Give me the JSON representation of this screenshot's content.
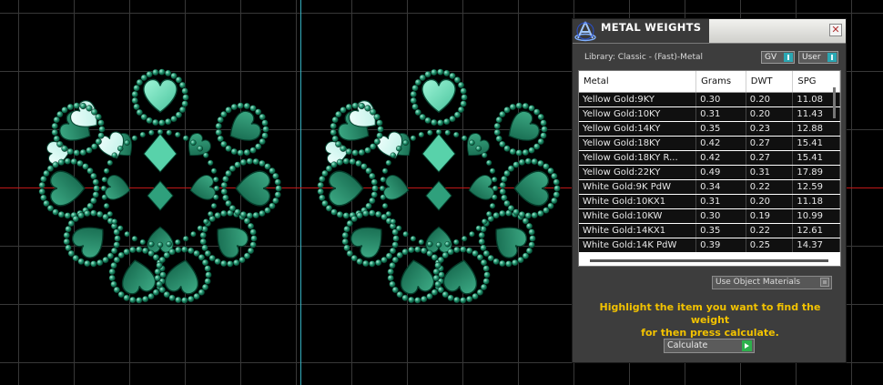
{
  "panel": {
    "title": "METAL WEIGHTS",
    "close_icon": "close-icon",
    "logo_icon": "matrix-logo-icon",
    "library_label": "Library: Classic - (Fast)-Metal",
    "gv_toggle": "GV",
    "user_toggle": "User",
    "table": {
      "columns": [
        "Metal",
        "Grams",
        "DWT",
        "SPG"
      ],
      "rows": [
        [
          "Yellow Gold:9KY",
          "0.30",
          "0.20",
          "11.08"
        ],
        [
          "Yellow Gold:10KY",
          "0.31",
          "0.20",
          "11.43"
        ],
        [
          "Yellow Gold:14KY",
          "0.35",
          "0.23",
          "12.88"
        ],
        [
          "Yellow Gold:18KY",
          "0.42",
          "0.27",
          "15.41"
        ],
        [
          "Yellow Gold:18KY R...",
          "0.42",
          "0.27",
          "15.41"
        ],
        [
          "Yellow Gold:22KY",
          "0.49",
          "0.31",
          "17.89"
        ],
        [
          "White Gold:9K PdW",
          "0.34",
          "0.22",
          "12.59"
        ],
        [
          "White Gold:10KX1",
          "0.31",
          "0.20",
          "11.18"
        ],
        [
          "White Gold:10KW",
          "0.30",
          "0.19",
          "10.99"
        ],
        [
          "White Gold:14KX1",
          "0.35",
          "0.22",
          "12.61"
        ],
        [
          "White Gold:14K PdW",
          "0.39",
          "0.25",
          "14.37"
        ]
      ]
    },
    "use_object_materials": "Use Object Materials",
    "instructions_line1": "Highlight the item you want to find the weight",
    "instructions_line2": "for then press calculate.",
    "calculate_button": "Calculate"
  },
  "colors": {
    "accent_teal": "#2aa7b3",
    "instruction_yellow": "#f2c200",
    "go_green": "#2db04c",
    "axis_cyan": "#35b0c0",
    "axis_red": "#c01818",
    "grid_gray": "#3a3a3a",
    "jewel_green": "#1f7a5c"
  }
}
